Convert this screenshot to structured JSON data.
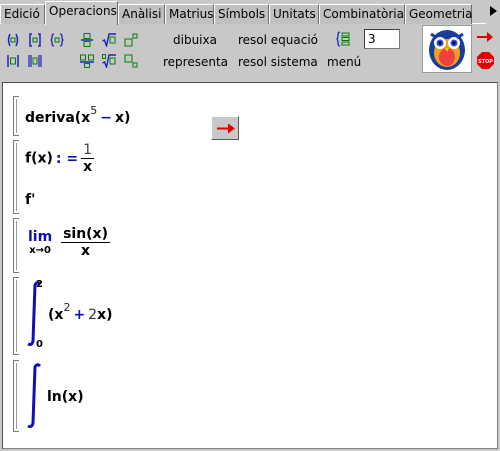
{
  "tabs": [
    "Edició",
    "Operacions",
    "Anàlisi",
    "Matrius",
    "Símbols",
    "Unitats",
    "Combinatòria",
    "Geometria"
  ],
  "active_tab": "Operacions",
  "toolbar": {
    "dibuixa": "dibuixa",
    "resol_equacio": "resol equació",
    "representa": "representa",
    "resol_sistema": "resol sistema",
    "menu": "menú",
    "precision_value": "3"
  },
  "expressions": {
    "deriva": {
      "func": "deriva",
      "open": "(x",
      "exp": "5",
      "minus": "−",
      "tail": "x)"
    },
    "fdef": {
      "lhs": "f(x)",
      "assign": ": =",
      "num": "1",
      "den": "x"
    },
    "fprime": "f'",
    "limit": {
      "lim": "lim",
      "sub": "x→0",
      "num": "sin(x)",
      "den": "x"
    },
    "integral1": {
      "upper": "2",
      "lower": "0",
      "open": "(x",
      "exp": "2",
      "plus": "+",
      "two": "2",
      "tail": "x)"
    },
    "integral2": {
      "body": "ln(x)"
    }
  },
  "colors": {
    "background": "#c8c8c8",
    "sheet": "#ffffff",
    "math_blue": "#1010b0",
    "arrow_red": "#e00000",
    "icon_blue": "#2020c0",
    "icon_green": "#008000"
  },
  "icons": [
    "parens-icon",
    "brackets-icon",
    "braces-icon",
    "abs-icon",
    "double-bar-icon",
    "fraction-icon",
    "sqrt-icon",
    "power-icon",
    "subscript-fraction-icon",
    "nth-root-icon",
    "subscript-icon",
    "list-icon",
    "logo-owl-icon",
    "go-arrow-icon",
    "stop-icon",
    "execute-arrow-icon"
  ]
}
